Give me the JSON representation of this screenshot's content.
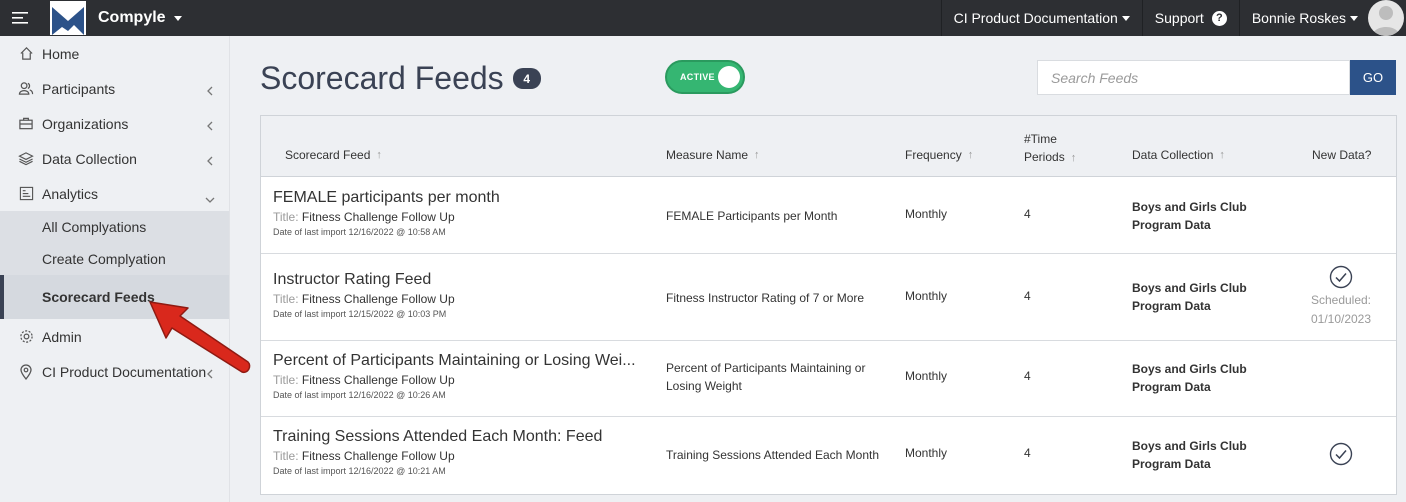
{
  "app": {
    "name": "Compyle"
  },
  "topbar": {
    "menus": [
      {
        "label": "CI Product Documentation"
      },
      {
        "label": "Support"
      },
      {
        "label": "Bonnie Roskes"
      }
    ]
  },
  "sidebar": {
    "items": [
      {
        "label": "Home"
      },
      {
        "label": "Participants"
      },
      {
        "label": "Organizations"
      },
      {
        "label": "Data Collection"
      },
      {
        "label": "Analytics"
      },
      {
        "label": "Admin"
      },
      {
        "label": "CI Product Documentation"
      }
    ],
    "analytics_sub": [
      {
        "label": "All Complyations"
      },
      {
        "label": "Create Complyation"
      },
      {
        "label": "Scorecard Feeds"
      }
    ]
  },
  "page": {
    "title": "Scorecard Feeds",
    "count": "4",
    "toggle_label": "ACTIVE",
    "search_placeholder": "Search Feeds",
    "go_label": "GO"
  },
  "table": {
    "headers": {
      "feed": "Scorecard Feed",
      "measure": "Measure Name",
      "frequency": "Frequency",
      "periods_line1": "#Time",
      "periods_line2": "Periods",
      "collection": "Data Collection",
      "new_data": "New Data?"
    },
    "title_label": "Title:",
    "rows": [
      {
        "feed": "FEMALE participants per month",
        "title": "Fitness Challenge Follow Up",
        "date": "Date of last import 12/16/2022 @ 10:58 AM",
        "measure": "FEMALE Participants per Month",
        "frequency": "Monthly",
        "periods": "4",
        "collection_line1": "Boys and Girls Club",
        "collection_line2": "Program Data",
        "new_data": ""
      },
      {
        "feed": "Instructor Rating Feed",
        "title": "Fitness Challenge Follow Up",
        "date": "Date of last import 12/15/2022 @ 10:03 PM",
        "measure": "Fitness Instructor Rating of 7 or More",
        "frequency": "Monthly",
        "periods": "4",
        "collection_line1": "Boys and Girls Club",
        "collection_line2": "Program Data",
        "new_data": "check",
        "scheduled_label": "Scheduled:",
        "scheduled_date": "01/10/2023"
      },
      {
        "feed": "Percent of Participants Maintaining or Losing Wei...",
        "title": "Fitness Challenge Follow Up",
        "date": "Date of last import 12/16/2022 @ 10:26 AM",
        "measure": "Percent of Participants Maintaining or Losing Weight",
        "frequency": "Monthly",
        "periods": "4",
        "collection_line1": "Boys and Girls Club",
        "collection_line2": "Program Data",
        "new_data": ""
      },
      {
        "feed": "Training Sessions Attended Each Month: Feed",
        "title": "Fitness Challenge Follow Up",
        "date": "Date of last import 12/16/2022 @ 10:21 AM",
        "measure": "Training Sessions Attended Each Month",
        "frequency": "Monthly",
        "periods": "4",
        "collection_line1": "Boys and Girls Club",
        "collection_line2": "Program Data",
        "new_data": "check"
      }
    ]
  },
  "colors": {
    "topbar": "#2d2f33",
    "accent": "#3a4254",
    "toggle_green": "#35b672",
    "go_blue": "#2c5289",
    "annotation_arrow": "#d9281c"
  },
  "icons": {
    "menu": "hamburger-icon",
    "home": "home-icon",
    "participants": "users-icon",
    "organizations": "briefcase-icon",
    "data_collection": "layers-icon",
    "analytics": "chart-icon",
    "admin": "gear-icon",
    "docs": "map-pin-icon"
  }
}
